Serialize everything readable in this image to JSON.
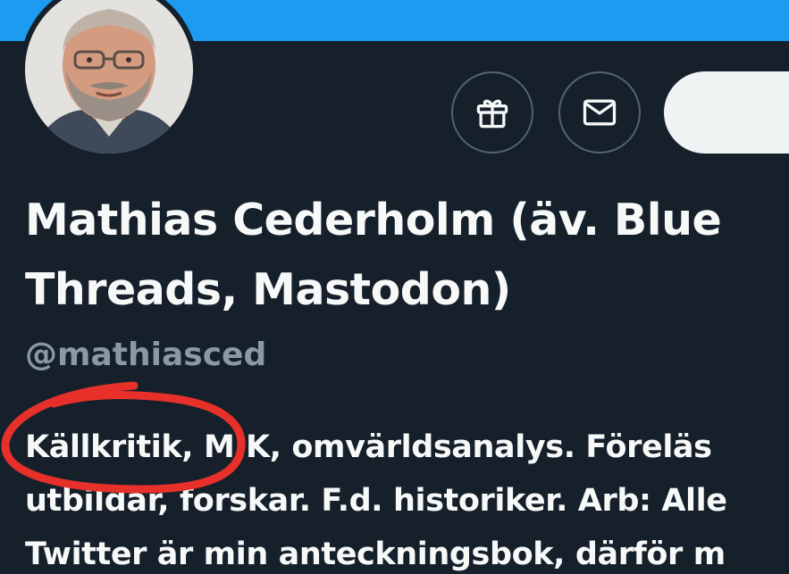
{
  "profile": {
    "display_name_line1": "Mathias Cederholm (äv. Blue",
    "display_name_line2": "Threads, Mastodon)",
    "handle": "@mathiasced",
    "bio_lines": [
      "Källkritik, MIK, omvärldsanalys. Föreläs",
      "utbildar, forskar. F.d. historiker. Arb: Alle",
      "Twitter är min anteckningsbok, därför m"
    ]
  },
  "actions": {
    "gift_icon": "gift-icon",
    "mail_icon": "mail-icon"
  },
  "colors": {
    "banner": "#1d9bf0",
    "background": "#15202b",
    "text_primary": "#f7f9f9",
    "text_secondary": "#8b98a5",
    "button_border": "#536471",
    "follow_button": "#eff3f4",
    "annotation_circle": "#e8302a"
  }
}
